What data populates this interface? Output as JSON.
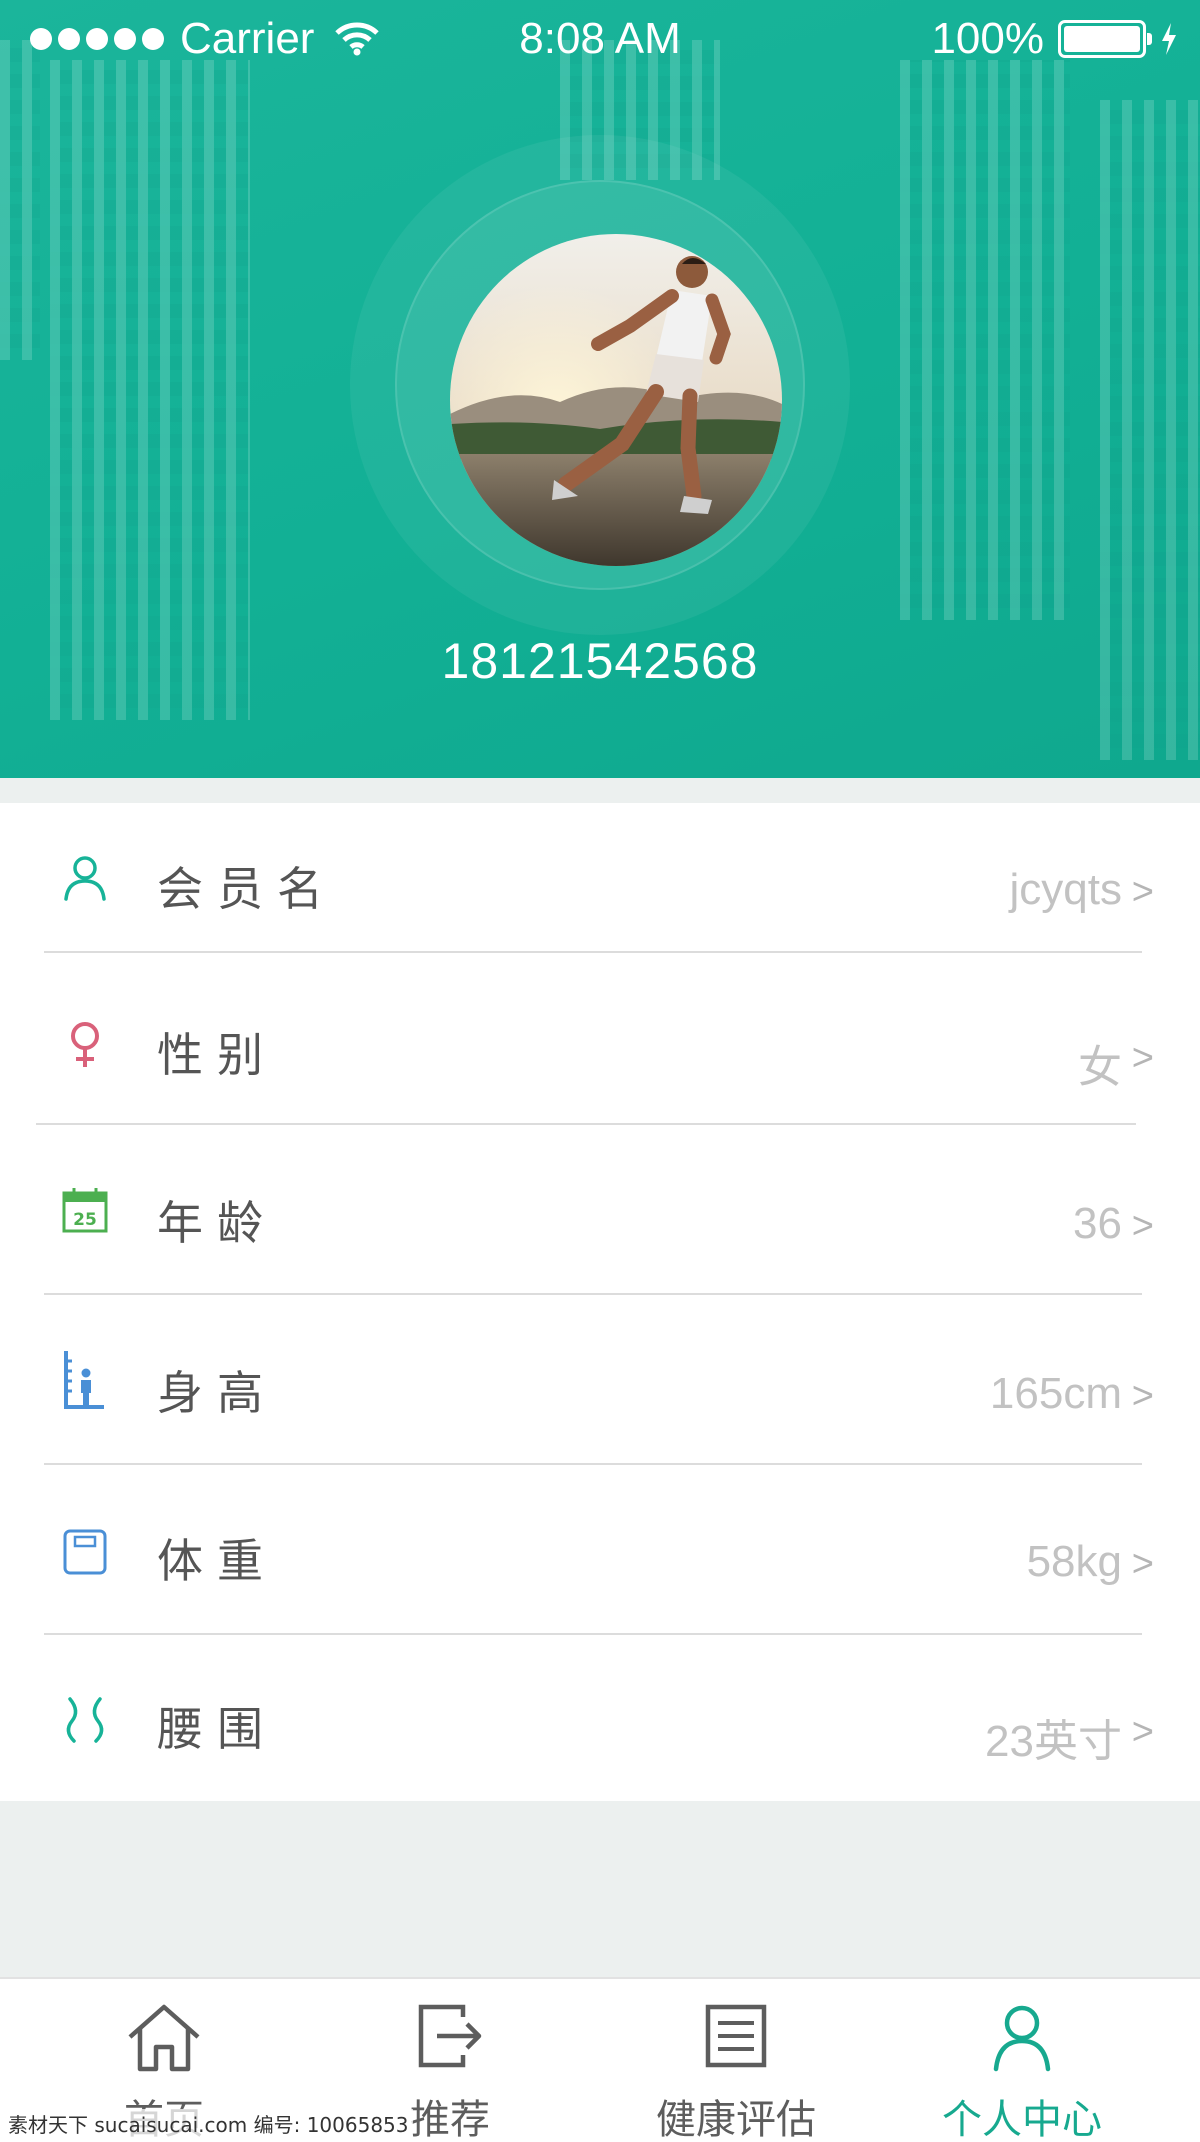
{
  "status_bar": {
    "carrier": "Carrier",
    "time": "8:08 AM",
    "battery": "100%"
  },
  "profile": {
    "phone": "18121542568",
    "avatar_icon": "runner-photo"
  },
  "fields": [
    {
      "label": "会员名",
      "value": "jcyqts",
      "arrow": ">",
      "icon": "user-icon"
    },
    {
      "label": "性别",
      "value": "女",
      "arrow": ">",
      "icon": "female-icon"
    },
    {
      "label": "年龄",
      "value": "36",
      "arrow": ">",
      "icon": "calendar-icon",
      "icon_text": "25"
    },
    {
      "label": "身高",
      "value": "165cm",
      "arrow": ">",
      "icon": "height-icon"
    },
    {
      "label": "体重",
      "value": "58kg",
      "arrow": ">",
      "icon": "scale-icon"
    },
    {
      "label": "腰围",
      "value": "23英寸",
      "arrow": ">",
      "icon": "waist-icon"
    }
  ],
  "tabs": [
    {
      "label": "首页",
      "icon": "home-icon"
    },
    {
      "label": "推荐",
      "icon": "share-icon"
    },
    {
      "label": "健康评估",
      "icon": "document-icon"
    },
    {
      "label": "个人中心",
      "icon": "person-icon",
      "active": true
    }
  ],
  "colors": {
    "primary": "#17b398",
    "active_tab": "#17a98f",
    "female": "#d9617a",
    "calendar": "#4caf50",
    "height": "#4a8fd6"
  },
  "watermark": "素材天下 sucaisucai.com 编号: 10065853"
}
